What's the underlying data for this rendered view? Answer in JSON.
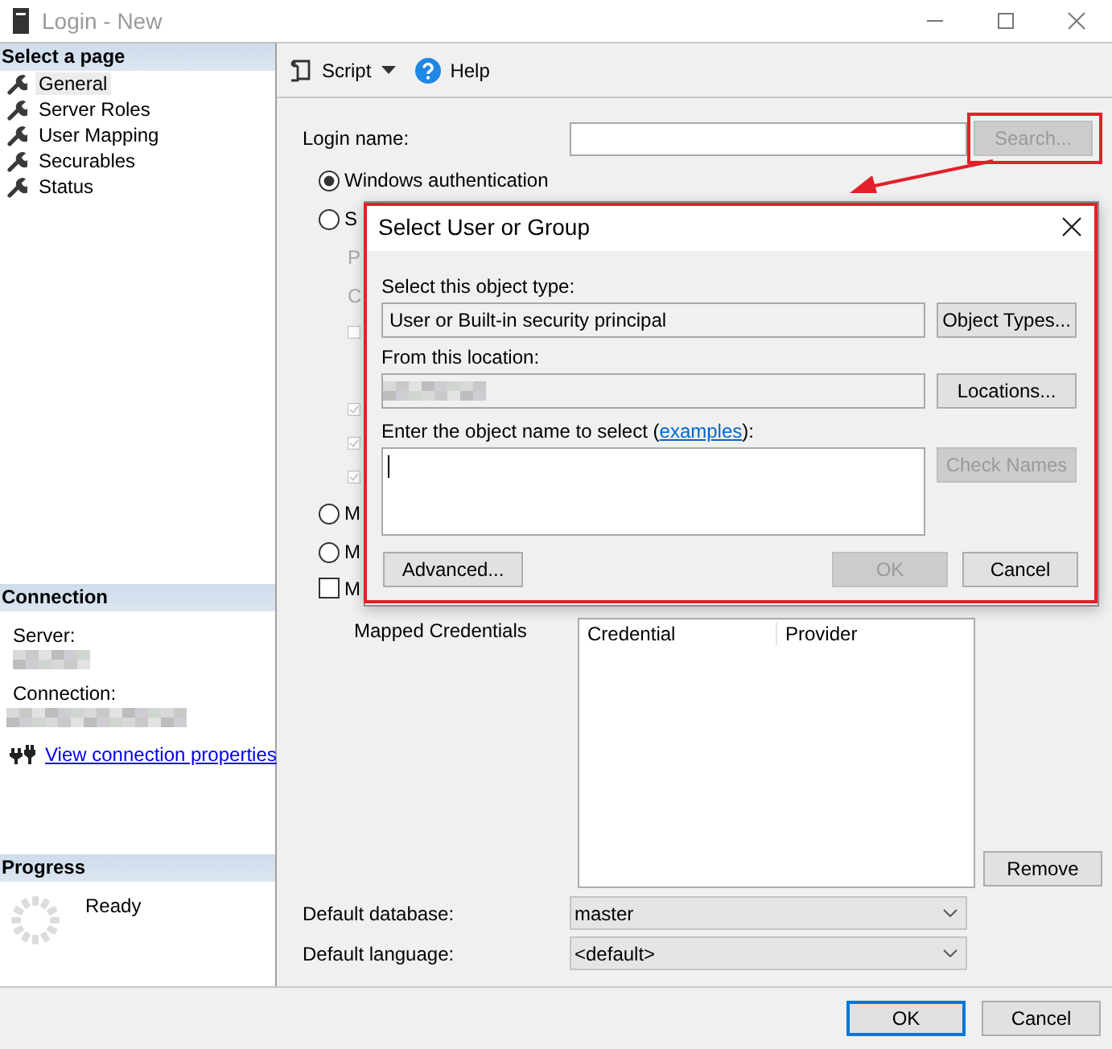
{
  "window": {
    "title": "Login - New"
  },
  "sidebar": {
    "header": "Select a page",
    "items": [
      {
        "label": "General",
        "selected": true
      },
      {
        "label": "Server Roles",
        "selected": false
      },
      {
        "label": "User Mapping",
        "selected": false
      },
      {
        "label": "Securables",
        "selected": false
      },
      {
        "label": "Status",
        "selected": false
      }
    ]
  },
  "connection": {
    "header": "Connection",
    "server_label": "Server:",
    "connection_label": "Connection:",
    "link": "View connection properties"
  },
  "progress": {
    "header": "Progress",
    "status": "Ready"
  },
  "toolbar": {
    "script": "Script",
    "help": "Help"
  },
  "form": {
    "login_label": "Login name:",
    "search_button": {
      "label": "Search...",
      "disabled": true
    },
    "auth_options": [
      {
        "kind": "radio",
        "label": "Windows authentication",
        "selected": true
      },
      {
        "kind": "radio",
        "label": "S",
        "selected": false,
        "children": [
          {
            "kind": "label",
            "label": "P",
            "disabled": true
          },
          {
            "kind": "label",
            "label": "C",
            "disabled": true
          },
          {
            "kind": "checkbox",
            "checked": false,
            "disabled": true
          },
          {
            "kind": "checkbox",
            "checked": true,
            "disabled": true
          },
          {
            "kind": "checkbox",
            "checked": true,
            "disabled": true
          },
          {
            "kind": "checkbox",
            "checked": true,
            "disabled": true
          }
        ]
      },
      {
        "kind": "radio",
        "label": "M",
        "selected": false
      },
      {
        "kind": "radio",
        "label": "M",
        "selected": false
      },
      {
        "kind": "checkbox",
        "label": "M",
        "checked": false
      }
    ],
    "credentials": {
      "label": "Mapped Credentials",
      "columns": [
        "Credential",
        "Provider"
      ],
      "remove_button": "Remove"
    },
    "default_database": {
      "label": "Default database:",
      "value": "master"
    },
    "default_language": {
      "label": "Default language:",
      "value": "<default>"
    }
  },
  "dialog": {
    "title": "Select User or Group",
    "object_type_label": "Select this object type:",
    "object_type_value": "User or Built-in security principal",
    "object_types_button": "Object Types...",
    "location_label": "From this location:",
    "locations_button": "Locations...",
    "name_label_before": "Enter the object name to select (",
    "name_link": "examples",
    "name_label_after": "):",
    "check_names_button": {
      "label": "Check Names",
      "disabled": true
    },
    "advanced_button": "Advanced...",
    "ok_button": {
      "label": "OK",
      "disabled": true
    },
    "cancel_button": "Cancel"
  },
  "footer": {
    "ok": "OK",
    "cancel": "Cancel"
  }
}
